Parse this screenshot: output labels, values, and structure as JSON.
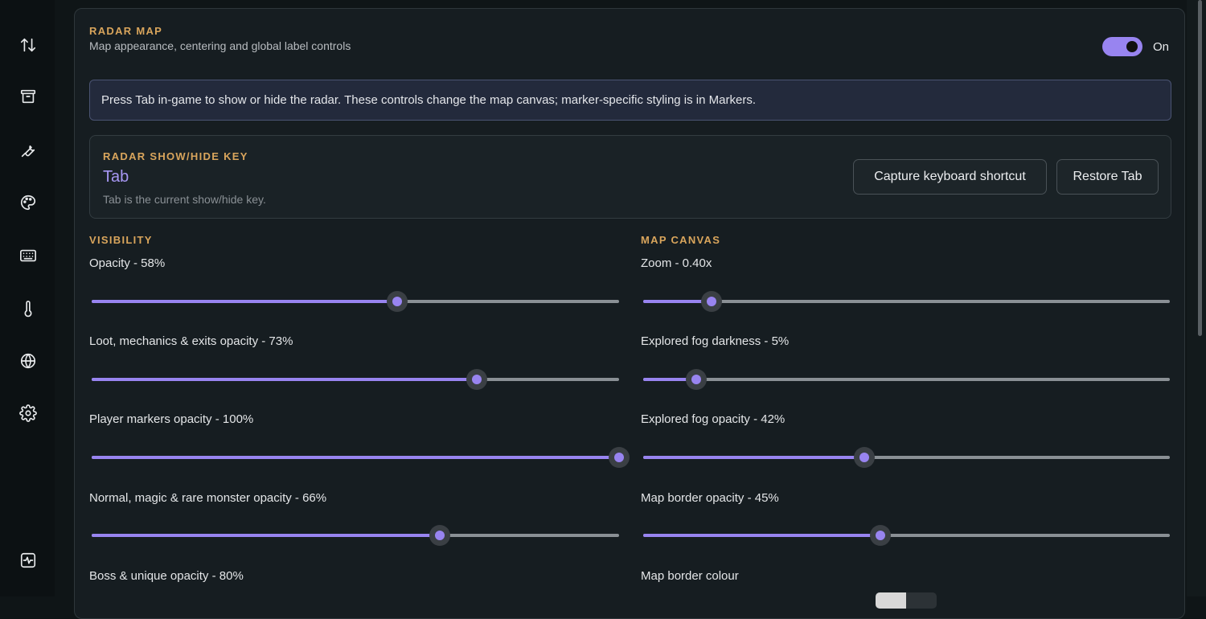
{
  "sidebar": {
    "icons": [
      "sort-arrows-icon",
      "archive-box-icon",
      "wrench-icon",
      "palette-icon",
      "keyboard-icon",
      "thermometer-icon",
      "globe-icon",
      "gear-icon",
      "activity-icon"
    ]
  },
  "radar": {
    "title": "RADAR MAP",
    "subtitle": "Map appearance, centering and global label controls",
    "toggle_label": "On",
    "toggle_on": true,
    "info": "Press Tab in-game to show or hide the radar. These controls change the map canvas; marker-specific styling is in Markers."
  },
  "key": {
    "title": "RADAR SHOW/HIDE KEY",
    "value": "Tab",
    "help": "Tab is the current show/hide key.",
    "capture_label": "Capture keyboard shortcut",
    "restore_label": "Restore Tab"
  },
  "visibility": {
    "title": "VISIBILITY",
    "sliders": [
      {
        "label": "Opacity - 58%",
        "value": 0.58
      },
      {
        "label": "Loot, mechanics & exits opacity - 73%",
        "value": 0.73
      },
      {
        "label": "Player markers opacity - 100%",
        "value": 1.0
      },
      {
        "label": "Normal, magic & rare monster opacity - 66%",
        "value": 0.66
      },
      {
        "label": "Boss & unique opacity - 80%",
        "value": 0.8
      }
    ]
  },
  "canvas": {
    "title": "MAP CANVAS",
    "sliders": [
      {
        "label": "Zoom - 0.40x",
        "value": 0.13
      },
      {
        "label": "Explored fog darkness - 5%",
        "value": 0.1
      },
      {
        "label": "Explored fog opacity - 42%",
        "value": 0.42
      },
      {
        "label": "Map border opacity - 45%",
        "value": 0.45
      }
    ],
    "border_colour_label": "Map border colour"
  },
  "colors": {
    "accent": "#9884f0",
    "section_title": "#d9a55c"
  }
}
